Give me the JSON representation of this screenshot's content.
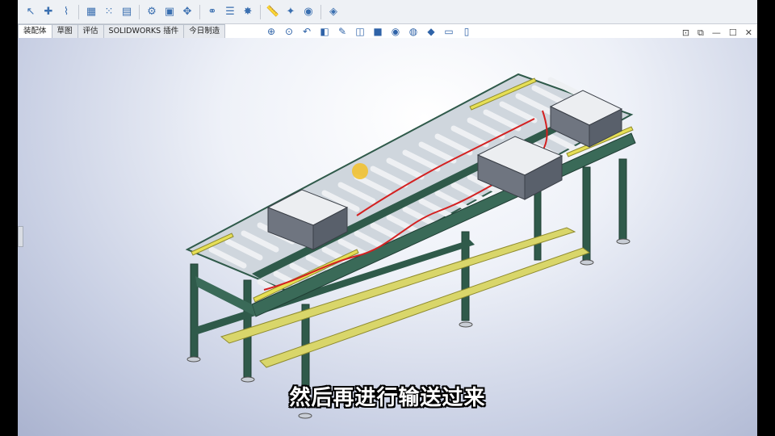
{
  "toolbar": {
    "icons": [
      "select-icon",
      "new-component-icon",
      "paperclip-icon",
      "table-icon",
      "grid-pattern-icon",
      "folder-open-icon",
      "assembly-icon",
      "insert-component-icon",
      "move-component-icon",
      "mate-icon",
      "bom-icon",
      "explode-icon",
      "ruler-icon",
      "lightbulb-icon",
      "camera-icon",
      "render-icon"
    ]
  },
  "tabs": [
    "装配体",
    "草图",
    "评估",
    "SOLIDWORKS 插件",
    "今日制造"
  ],
  "active_tab": "装配体",
  "heads_up": {
    "icons": [
      "zoom-fit-icon",
      "zoom-area-icon",
      "previous-view-icon",
      "section-view-icon",
      "dynamic-annotation-icon",
      "view-orientation-icon",
      "display-style-icon",
      "hide-show-icon",
      "edit-appearance-icon",
      "apply-scene-icon",
      "view-settings-icon",
      "split-view-icon"
    ]
  },
  "window_controls": {
    "expand": "⊡",
    "restore": "⧉",
    "minimize": "—",
    "maximize": "☐",
    "close": "✕"
  },
  "subtitle": "然后再进行输送过来",
  "colors": {
    "frame": "#2f5a4a",
    "rail": "#d9d66a",
    "roller": "#e8eaee",
    "wire": "#d42020",
    "box": "#e4e6ea"
  }
}
